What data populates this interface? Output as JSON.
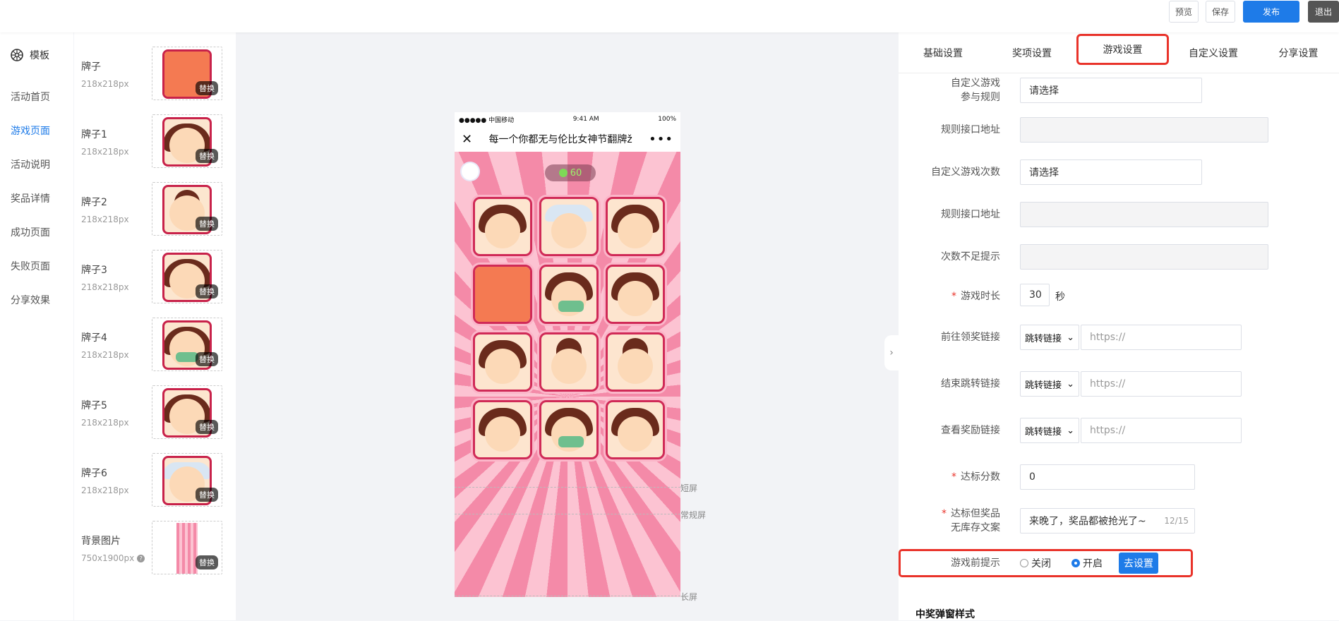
{
  "toolbar": {
    "preview_label": "预览",
    "save_label": "保存",
    "publish_label": "发布",
    "exit_label": "退出"
  },
  "sidebar": {
    "title": "模板",
    "items": [
      {
        "label": "活动首页",
        "active": false
      },
      {
        "label": "游戏页面",
        "active": true
      },
      {
        "label": "活动说明",
        "active": false
      },
      {
        "label": "奖品详情",
        "active": false
      },
      {
        "label": "成功页面",
        "active": false
      },
      {
        "label": "失败页面",
        "active": false
      },
      {
        "label": "分享效果",
        "active": false
      }
    ]
  },
  "assets": [
    {
      "name": "牌子",
      "size": "218x218px",
      "replace": "替换"
    },
    {
      "name": "牌子1",
      "size": "218x218px",
      "replace": "替换"
    },
    {
      "name": "牌子2",
      "size": "218x218px",
      "replace": "替换"
    },
    {
      "name": "牌子3",
      "size": "218x218px",
      "replace": "替换"
    },
    {
      "name": "牌子4",
      "size": "218x218px",
      "replace": "替换"
    },
    {
      "name": "牌子5",
      "size": "218x218px",
      "replace": "替换"
    },
    {
      "name": "牌子6",
      "size": "218x218px",
      "replace": "替换"
    },
    {
      "name": "背景图片",
      "size": "750x1900px",
      "replace": "替换"
    }
  ],
  "phone": {
    "carrier": "●●●●● 中国移动",
    "time": "9:41 AM",
    "battery": "100%",
    "title": "每一个你都无与伦比女神节翻牌ž",
    "timer": "60"
  },
  "markers": {
    "short": "短屏",
    "normal": "常规屏",
    "long": "长屏"
  },
  "tabs": [
    {
      "label": "基础设置",
      "active": false
    },
    {
      "label": "奖项设置",
      "active": false
    },
    {
      "label": "游戏设置",
      "active": true
    },
    {
      "label": "自定义设置",
      "active": false
    },
    {
      "label": "分享设置",
      "active": false
    }
  ],
  "form": {
    "custom_rule_label_1": "自定义游戏",
    "custom_rule_label_2": "参与规则",
    "custom_rule_value": "请选择",
    "rule_api_label": "规则接口地址",
    "custom_count_label": "自定义游戏次数",
    "custom_count_value": "请选择",
    "rule_api_label_2": "规则接口地址",
    "insufficient_label": "次数不足提示",
    "duration_label": "游戏时长",
    "duration_value": "30",
    "duration_unit": "秒",
    "prize_link_label": "前往领奖链接",
    "prize_link_type": "跳转链接",
    "prize_link_placeholder": "https://",
    "end_link_label": "结束跳转链接",
    "end_link_type": "跳转链接",
    "end_link_placeholder": "https://",
    "reward_link_label": "查看奖励链接",
    "reward_link_type": "跳转链接",
    "reward_link_placeholder": "https://",
    "target_score_label": "达标分数",
    "target_score_value": "0",
    "no_stock_label_1": "达标但奖品",
    "no_stock_label_2": "无库存文案",
    "no_stock_value": "来晚了，奖品都被抢光了~",
    "no_stock_count": "12/15",
    "pregame_label": "游戏前提示",
    "pregame_off": "关闭",
    "pregame_on": "开启",
    "pregame_selected": "on",
    "pregame_button": "去设置",
    "popup_section_title": "中奖弹窗样式"
  },
  "colors": {
    "accent": "#1e7be8",
    "highlight": "#e9332a",
    "card_border": "#c8224a"
  }
}
